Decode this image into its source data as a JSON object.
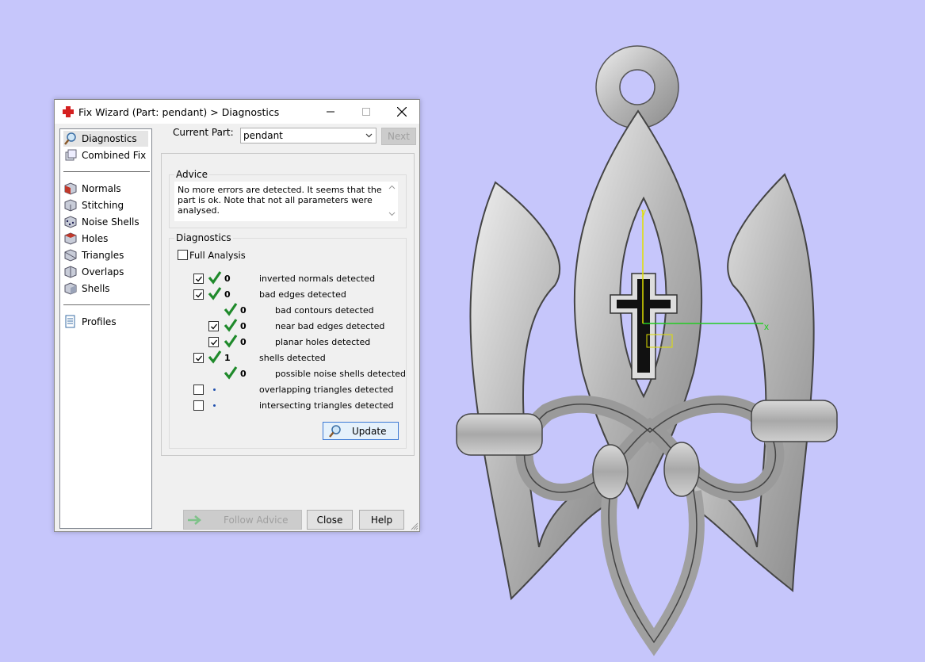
{
  "window": {
    "title": "Fix Wizard (Part: pendant) > Diagnostics",
    "minimize_icon": "minimize-icon",
    "maximize_icon": "maximize-icon",
    "close_icon": "close-icon"
  },
  "nav": {
    "items": [
      {
        "label": "Diagnostics",
        "icon": "magnifier-icon",
        "selected": true
      },
      {
        "label": "Combined Fix",
        "icon": "combined-fix-icon"
      },
      {
        "label": "Normals",
        "icon": "normals-cube-icon"
      },
      {
        "label": "Stitching",
        "icon": "stitching-cube-icon"
      },
      {
        "label": "Noise Shells",
        "icon": "noise-shells-icon"
      },
      {
        "label": "Holes",
        "icon": "holes-cube-icon"
      },
      {
        "label": "Triangles",
        "icon": "triangles-cube-icon"
      },
      {
        "label": "Overlaps",
        "icon": "overlaps-cube-icon"
      },
      {
        "label": "Shells",
        "icon": "shells-cube-icon"
      },
      {
        "label": "Profiles",
        "icon": "profiles-document-icon"
      }
    ]
  },
  "current_part": {
    "label": "Current Part:",
    "value": "pendant",
    "next_label": "Next"
  },
  "advice": {
    "title": "Advice",
    "text": "No more errors are detected. It seems that the part is ok. Note that not all parameters were analysed."
  },
  "diagnostics": {
    "title": "Diagnostics",
    "full_analysis_label": "Full Analysis",
    "full_analysis_checked": false,
    "rows": [
      {
        "checked": true,
        "status": "ok",
        "count": "0",
        "label": "inverted normals detected",
        "level": 0
      },
      {
        "checked": true,
        "status": "ok",
        "count": "0",
        "label": "bad edges detected",
        "level": 0
      },
      {
        "checked": null,
        "status": "ok",
        "count": "0",
        "label": "bad contours detected",
        "level": 1
      },
      {
        "checked": true,
        "status": "ok",
        "count": "0",
        "label": "near bad edges detected",
        "level": 1
      },
      {
        "checked": true,
        "status": "ok",
        "count": "0",
        "label": "planar holes detected",
        "level": 1
      },
      {
        "checked": true,
        "status": "ok",
        "count": "1",
        "label": "shells detected",
        "level": 0
      },
      {
        "checked": null,
        "status": "ok",
        "count": "0",
        "label": "possible noise shells detected",
        "level": 1
      },
      {
        "checked": false,
        "status": "pending",
        "count": "",
        "label": "overlapping triangles detected",
        "level": 0
      },
      {
        "checked": false,
        "status": "pending",
        "count": "",
        "label": "intersecting triangles detected",
        "level": 0
      }
    ],
    "update_label": "Update"
  },
  "footer": {
    "follow_advice_label": "Follow Advice",
    "close_label": "Close",
    "help_label": "Help"
  },
  "viewport": {
    "background": "#c6c6fb",
    "axis_x_label": "x",
    "axis_y_label": "y",
    "axis_x_color": "#22cc22",
    "axis_y_color": "#e0e000"
  }
}
